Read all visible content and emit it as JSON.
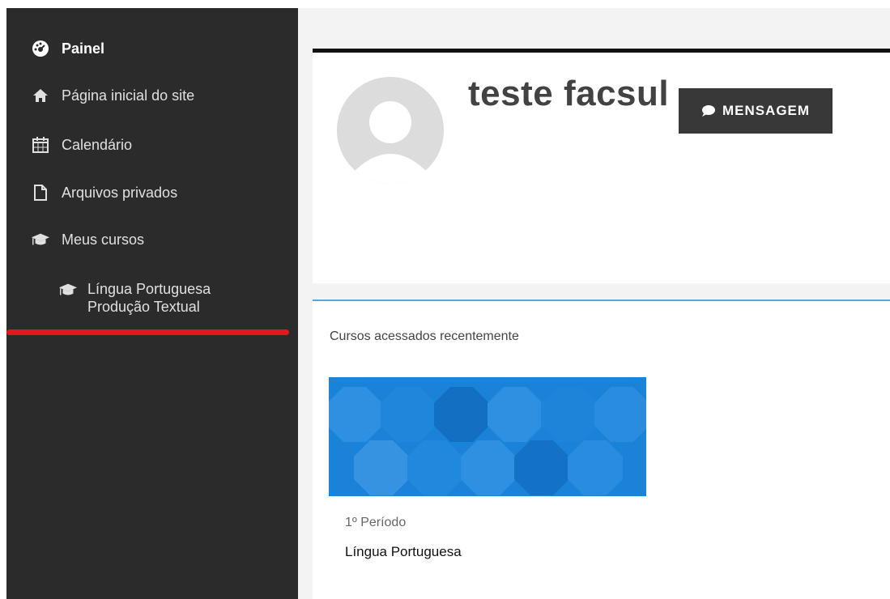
{
  "sidebar": {
    "items": [
      {
        "label": "Painel",
        "icon": "dashboard-icon"
      },
      {
        "label": "Página inicial do site",
        "icon": "home-icon"
      },
      {
        "label": "Calendário",
        "icon": "calendar-icon"
      },
      {
        "label": "Arquivos privados",
        "icon": "file-icon"
      },
      {
        "label": "Meus cursos",
        "icon": "graduation-cap-icon"
      }
    ],
    "sub_course": {
      "line1": "Língua Portuguesa",
      "line2": "Produção Textual",
      "icon": "graduation-cap-icon"
    }
  },
  "profile": {
    "name": "teste facsul",
    "message_button": "MENSAGEM"
  },
  "recent_courses": {
    "title": "Cursos acessados recentemente",
    "courses": [
      {
        "category": "1º Período",
        "name": "Língua Portuguesa"
      }
    ]
  },
  "colors": {
    "sidebar_bg": "#2b2b2b",
    "accent_red": "#e1191f",
    "accent_blue": "#5aa6d6",
    "course_tile": "#1a82d8"
  }
}
